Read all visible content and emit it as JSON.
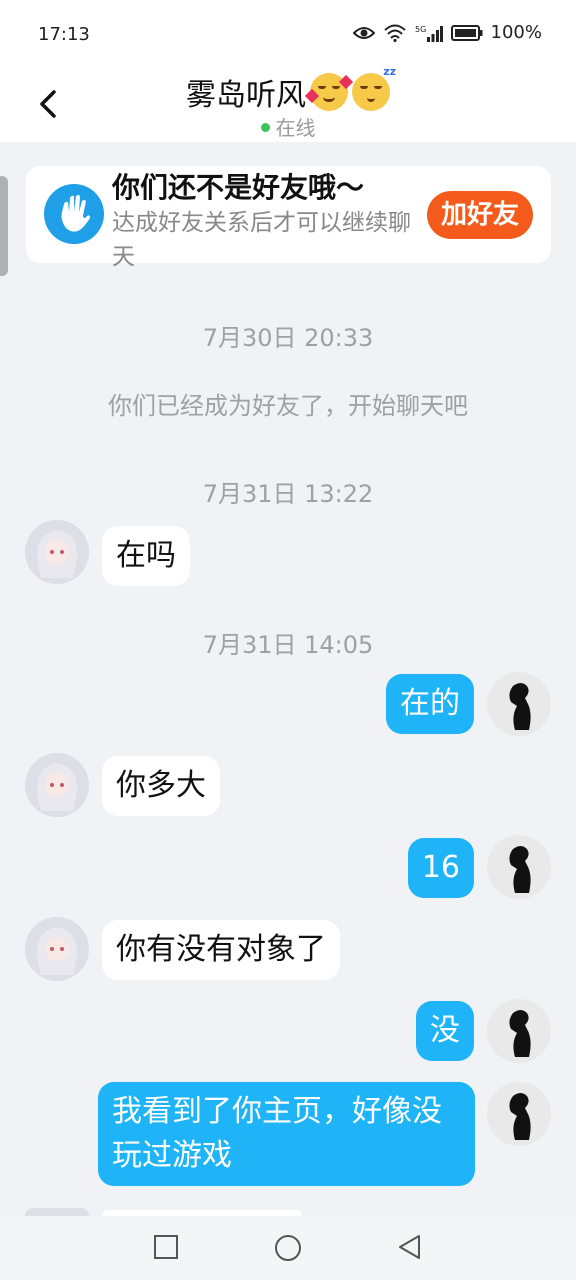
{
  "status_bar": {
    "time": "17:13",
    "battery": "100%",
    "icons": [
      "eye-icon",
      "wifi-icon",
      "signal-5g-icon",
      "battery-icon"
    ]
  },
  "header": {
    "title": "雾岛听风",
    "emojis": [
      "smiling-face-with-hearts-icon",
      "sleeping-face-icon"
    ],
    "online_status": "在线",
    "online_color": "#3ec35a"
  },
  "notice": {
    "title": "你们还不是好友哦～",
    "description": "达成好友关系后才可以继续聊天",
    "button_label": "加好友",
    "button_color": "#f35a1b",
    "icon": "hand-wave-icon"
  },
  "messages": [
    {
      "type": "time",
      "text": "7月30日 20:33"
    },
    {
      "type": "system",
      "text": "你们已经成为好友了，开始聊天吧"
    },
    {
      "type": "time",
      "text": "7月31日 13:22"
    },
    {
      "type": "in",
      "text": "在吗"
    },
    {
      "type": "time",
      "text": "7月31日 14:05"
    },
    {
      "type": "out",
      "text": "在的"
    },
    {
      "type": "in",
      "text": "你多大"
    },
    {
      "type": "out",
      "text": "16"
    },
    {
      "type": "in",
      "text": "你有没有对象了"
    },
    {
      "type": "out",
      "text": "没"
    },
    {
      "type": "out",
      "text": "我看到了你主页，好像没玩过游戏"
    }
  ],
  "colors": {
    "outgoing_bubble": "#1fb4f8",
    "incoming_bubble": "#ffffff",
    "background": "#f1f2f6"
  },
  "nav_bar": {
    "buttons": [
      "recent-apps-icon",
      "home-icon",
      "back-icon"
    ]
  }
}
